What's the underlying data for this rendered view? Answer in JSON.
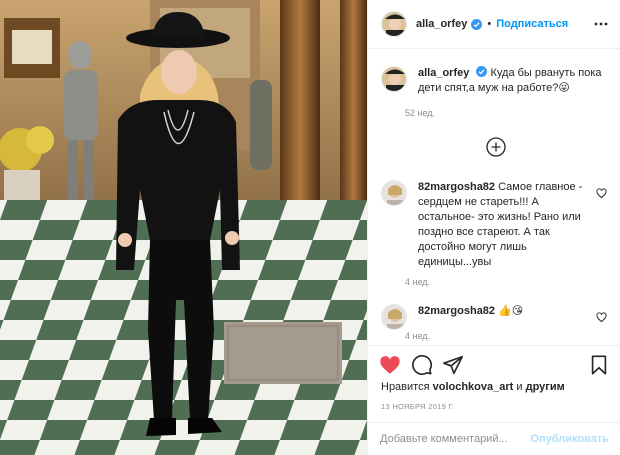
{
  "post": {
    "author": "alla_orfey",
    "separator": "•",
    "follow_label": "Подписаться",
    "caption_text": "Куда бы рвануть пока дети спят,а муж на работе?😜",
    "caption_time": "52 нед."
  },
  "comments": [
    {
      "user": "82margosha82",
      "text": "Самое главное - сердцем не стареть!!! А остальное- это жизнь! Рано или поздно все стареют. А так достойно могут лишь единицы...увы",
      "time": "4 нед."
    },
    {
      "user": "82margosha82",
      "text": "👍😘",
      "time": "4 нед."
    }
  ],
  "likes": {
    "prefix": "Нравится",
    "user": "volochkova_art",
    "middle": "и",
    "others": "другим"
  },
  "date": "13 НОЯБРЯ 2019 Г.",
  "add_comment": {
    "placeholder": "Добавьте комментарий...",
    "publish_label": "Опубликовать"
  },
  "icons": {
    "verified": "verified-badge-icon",
    "more": "more-horizontal-icon",
    "load_more": "plus-circle-icon",
    "like": "heart-icon",
    "comment": "comment-bubble-icon",
    "share": "paper-plane-icon",
    "save": "bookmark-icon"
  },
  "colors": {
    "link": "#0095f6",
    "heart": "#ed4956",
    "muted": "#8e8e8e",
    "publish_disabled": "#b2dffc"
  }
}
